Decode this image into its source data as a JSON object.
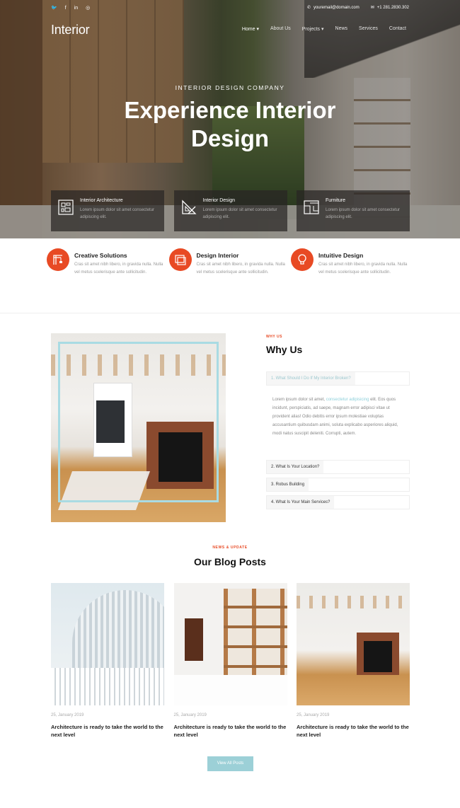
{
  "topbar": {
    "social": [
      {
        "icon": "twitter-icon",
        "glyph": "🐦"
      },
      {
        "icon": "facebook-icon",
        "glyph": "f"
      },
      {
        "icon": "linkedin-icon",
        "glyph": "in"
      },
      {
        "icon": "instagram-icon",
        "glyph": "◎"
      }
    ],
    "email": "youremail@domain.com",
    "phone": "+1 281.2830.302"
  },
  "header": {
    "logo": "Interior",
    "nav": [
      {
        "label": "Home ▾",
        "active": true
      },
      {
        "label": "About Us",
        "active": false
      },
      {
        "label": "Projects ▾",
        "active": false
      },
      {
        "label": "News",
        "active": false
      },
      {
        "label": "Services",
        "active": false
      },
      {
        "label": "Contact",
        "active": false
      }
    ]
  },
  "hero": {
    "subtitle": "INTERIOR DESIGN COMPANY",
    "title": "Experience Interior Design"
  },
  "feature_cards": [
    {
      "title": "Interior Architecture",
      "text": "Lorem ipsum dolor sit amet consectetur adipiscing elit.",
      "icon": "blueprint-icon"
    },
    {
      "title": "Interior Design",
      "text": "Lorem ipsum dolor sit amet consectetur adipiscing elit.",
      "icon": "ruler-triangle-icon"
    },
    {
      "title": "Furniture",
      "text": "Lorem ipsum dolor sit amet consectetur adipiscing elit.",
      "icon": "floorplan-icon"
    }
  ],
  "features": [
    {
      "title": "Creative Solutions",
      "text": "Cras sit amet nibh libero, in gravida nulla. Nulla vel metus scelerisque ante sollicitudin.",
      "icon": "crane-icon"
    },
    {
      "title": "Design Interior",
      "text": "Cras sit amet nibh libero, in gravida nulla. Nulla vel metus scelerisque ante sollicitudin.",
      "icon": "layers-icon"
    },
    {
      "title": "Intuitive Design",
      "text": "Cras sit amet nibh libero, in gravida nulla. Nulla vel metus scelerisque ante sollicitudin.",
      "icon": "lightbulb-icon"
    }
  ],
  "why": {
    "kicker": "WHY US",
    "title": "Why Us",
    "accordion": [
      {
        "label": "1. What Should I Do If My Interior Broken?",
        "open": true
      },
      {
        "label": "2. What Is Your Location?",
        "open": false
      },
      {
        "label": "3. Robus Building",
        "open": false
      },
      {
        "label": "4. What Is Your Main Services?",
        "open": false
      }
    ],
    "body_pre": "Lorem ipsum dolor sit amet, ",
    "body_link": "consectetur adipisicing",
    "body_post": " elit. Eos quos incidunt, perspiciatis, ad saepe, magnam error adipisci vitae ut provident alias! Odio debitis error ipsum molestiae voluptas accusantium quibusdam animi, soluta explicabo asperiores aliquid, modi natus suscipit deleniti. Corrupti, autem."
  },
  "blog": {
    "kicker": "NEWS & UPDATE",
    "title": "Our Blog Posts",
    "posts": [
      {
        "date": "25, January 2019",
        "title": "Architecture is ready to take the world to the next level"
      },
      {
        "date": "25, January 2019",
        "title": "Architecture is ready to take the world to the next level"
      },
      {
        "date": "25, January 2019",
        "title": "Architecture is ready to take the world to the next level"
      }
    ],
    "view_all": "View All Posts"
  },
  "colors": {
    "accent": "#e84a24",
    "teal": "#9cd0d7"
  }
}
